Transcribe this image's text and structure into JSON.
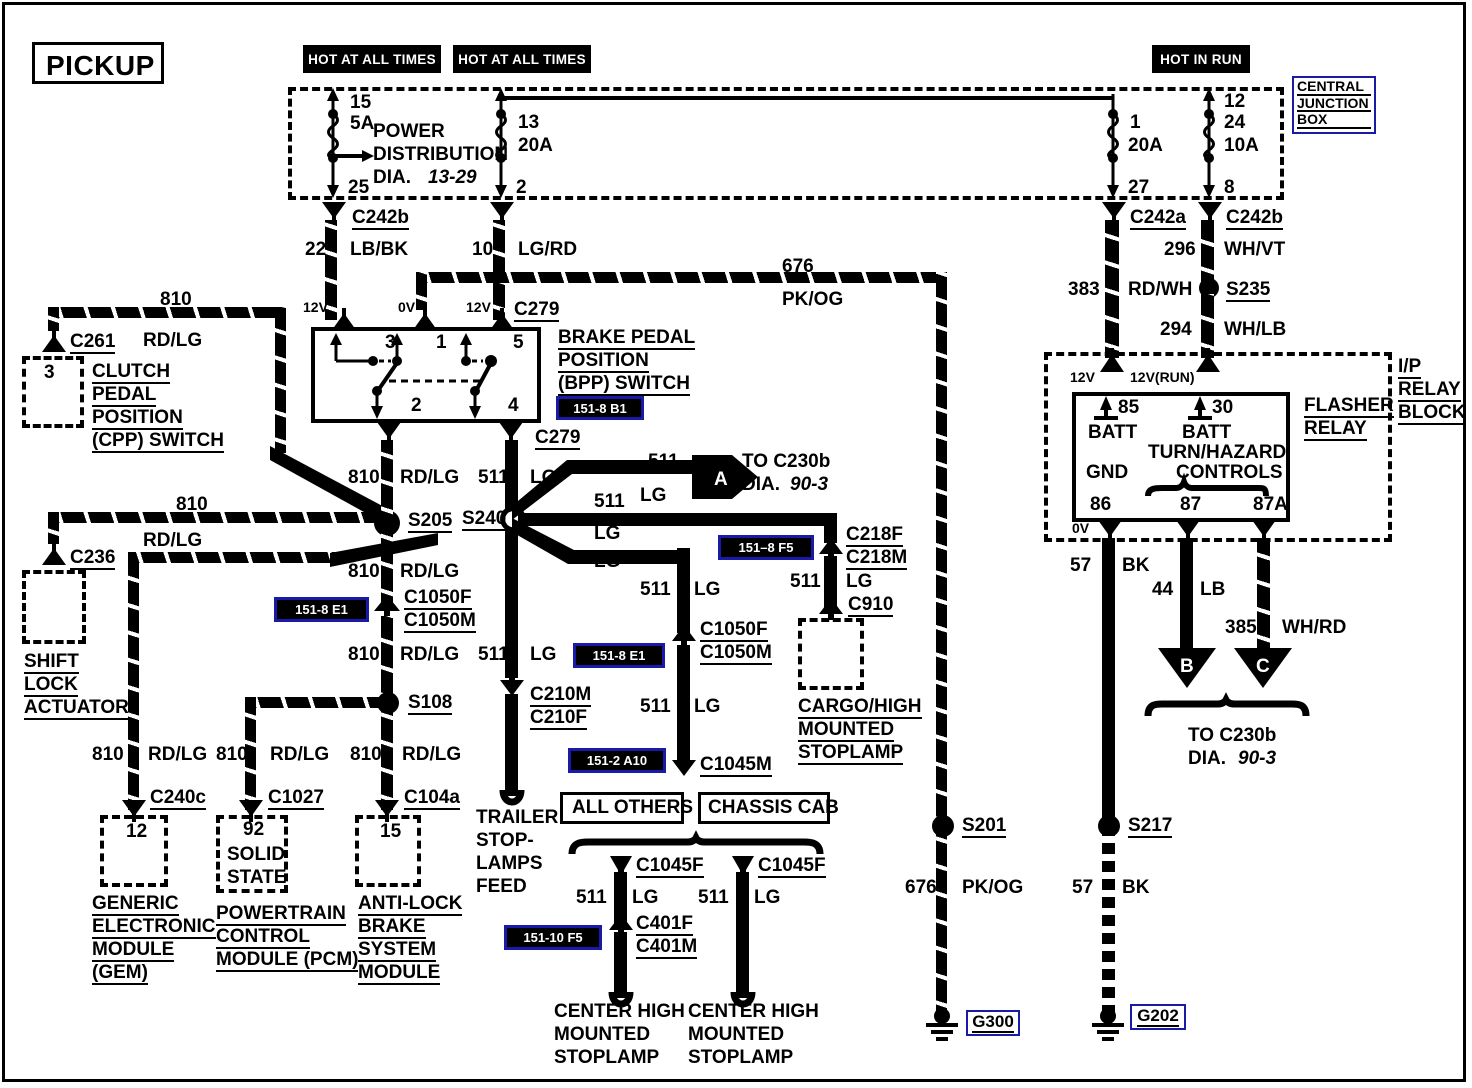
{
  "title": "PICKUP",
  "power_source_labels": {
    "hot_all_1": "HOT AT ALL TIMES",
    "hot_all_2": "HOT AT ALL TIMES",
    "hot_run": "HOT IN RUN"
  },
  "central_junction_box": {
    "label_line1": "CENTRAL",
    "label_line2": "JUNCTION",
    "label_line3": "BOX",
    "power_distribution": {
      "line1": "POWER",
      "line2": "DISTRIBUTION",
      "line3": "DIA.",
      "ref": "13-29"
    },
    "fuses": [
      {
        "top_pin": "15",
        "rating": "5A",
        "bottom_pin": "25"
      },
      {
        "top_pin": "13",
        "rating": "20A",
        "bottom_pin": "2"
      },
      {
        "top_pin": "1",
        "rating": "20A",
        "bottom_pin": "27"
      },
      {
        "top_pin": "12",
        "rating": "24",
        "rating2": "10A",
        "bottom_pin": "8"
      }
    ]
  },
  "connectors": {
    "c242b_left": "C242b",
    "c242a": "C242a",
    "c242b_right": "C242b",
    "c279_top": "C279",
    "c279_bottom": "C279",
    "c261": "C261",
    "c236": "C236",
    "c240c": "C240c",
    "c1027": "C1027",
    "c104a": "C104a",
    "c1050f_left": "C1050F",
    "c1050m_left": "C1050M",
    "c1050f_mid": "C1050F",
    "c1050m_mid": "C1050M",
    "c210m": "C210M",
    "c210f": "C210F",
    "c218f": "C218F",
    "c218m": "C218M",
    "c910": "C910",
    "c1045m": "C1045M",
    "c1045f_left": "C1045F",
    "c1045f_right": "C1045F",
    "c401f": "C401F",
    "c401m": "C401M"
  },
  "wires": {
    "lb_bk": {
      "gauge": "22",
      "color": "LB/BK"
    },
    "lg_rd": {
      "gauge": "10",
      "color": "LG/RD"
    },
    "pk_og_top": {
      "gauge": "676",
      "color": "PK/OG"
    },
    "rd_wh": {
      "gauge": "383",
      "color": "RD/WH"
    },
    "wh_vt": {
      "gauge": "296",
      "color": "WH/VT"
    },
    "wh_lb": {
      "gauge": "294",
      "color": "WH/LB"
    },
    "rd_lg_c261": {
      "gauge": "810",
      "color": "RD/LG"
    },
    "rd_lg_c236": {
      "gauge": "810",
      "color": "RD/LG"
    },
    "rd_lg_s205_up": {
      "gauge": "810",
      "color": "RD/LG"
    },
    "rd_lg_s205_dn": {
      "gauge": "810",
      "color": "RD/LG"
    },
    "rd_lg_s108_dn": {
      "gauge": "810",
      "color": "RD/LG"
    },
    "rd_lg_gem": {
      "gauge": "810",
      "color": "RD/LG"
    },
    "rd_lg_pcm": {
      "gauge": "810",
      "color": "RD/LG"
    },
    "rd_lg_abs": {
      "gauge": "810",
      "color": "RD/LG"
    },
    "lg_s240_up": {
      "gauge": "511",
      "color": "LG"
    },
    "lg_a_branch": {
      "gauge": "511",
      "color": "LG"
    },
    "lg_mid_branch": {
      "gauge": "511",
      "color": "LG"
    },
    "lg_low_branch": {
      "gauge": "511",
      "color": "LG"
    },
    "lg_trailer": {
      "gauge": "511",
      "color": "LG"
    },
    "lg_chmsl_feed": {
      "gauge": "511",
      "color": "LG"
    },
    "lg_chmsl_low": {
      "gauge": "511",
      "color": "LG"
    },
    "lg_cargo": {
      "gauge": "511",
      "color": "LG"
    },
    "lg_c1045f_left": {
      "gauge": "511",
      "color": "LG"
    },
    "lg_c1045f_right": {
      "gauge": "511",
      "color": "LG"
    },
    "bk_flasher": {
      "gauge": "57",
      "color": "BK"
    },
    "lb_flasher": {
      "gauge": "44",
      "color": "LB"
    },
    "wh_rd_flasher": {
      "gauge": "385",
      "color": "WH/RD"
    },
    "pk_og_ground": {
      "gauge": "676",
      "color": "PK/OG"
    },
    "bk_ground": {
      "gauge": "57",
      "color": "BK"
    }
  },
  "voltages": {
    "v_12_lbbk": "12V",
    "v_0_bpp": "0V",
    "v_12_lgrd": "12V",
    "v_12_flasher": "12V",
    "v_12run_flasher": "12V(RUN)",
    "v_0_gnd": "0V"
  },
  "bpp_switch": {
    "name_line1": "BRAKE PEDAL",
    "name_line2": "POSITION",
    "name_line3": "(BPP) SWITCH",
    "pins": [
      "3",
      "1",
      "5",
      "2",
      "4"
    ],
    "ref": "151-8 B1"
  },
  "cpp_switch": {
    "pin": "3",
    "name_line1": "CLUTCH",
    "name_line2": "PEDAL",
    "name_line3": "POSITION",
    "name_line4": "(CPP) SWITCH"
  },
  "shift_lock_actuator": {
    "name_line1": "SHIFT",
    "name_line2": "LOCK",
    "name_line3": "ACTUATOR"
  },
  "modules": [
    {
      "pin": "12",
      "inner": "",
      "name_lines": [
        "GENERIC",
        "ELECTRONIC",
        "MODULE",
        "(GEM)"
      ]
    },
    {
      "pin": "92",
      "inner": "SOLID STATE",
      "name_lines": [
        "POWERTRAIN",
        "CONTROL",
        "MODULE (PCM)"
      ]
    },
    {
      "pin": "15",
      "inner": "",
      "name_lines": [
        "ANTI-LOCK",
        "BRAKE",
        "SYSTEM",
        "MODULE"
      ]
    }
  ],
  "splices": {
    "s205": "S205",
    "s240": "S240",
    "s108": "S108",
    "s235": "S235",
    "s201": "S201",
    "s217": "S217"
  },
  "grounds": {
    "g300": "G300",
    "g202": "G202"
  },
  "refs": {
    "r_151_8_e1_left": "151-8 E1",
    "r_151_8_e1_mid": "151-8 E1",
    "r_151_8_f5": "151–8 F5",
    "r_151_2_a10": "151-2 A10",
    "r_151_10_f5": "151-10 F5",
    "r_151_8_b1": "151-8 B1"
  },
  "destinations": {
    "arrow_a": {
      "letter": "A",
      "line1": "TO C230b",
      "line2": "DIA.",
      "ref": "90-3"
    },
    "arrow_b": {
      "letter": "B"
    },
    "arrow_c": {
      "letter": "C"
    },
    "bc_group": {
      "line1": "TO C230b",
      "line2": "DIA.",
      "ref": "90-3"
    }
  },
  "flasher_relay": {
    "title_line1": "FLASHER",
    "title_line2": "RELAY",
    "pins": {
      "p85": "85",
      "p30": "30",
      "p86": "86",
      "p87": "87",
      "p87a": "87A"
    },
    "labels": {
      "batt_left": "BATT",
      "batt_right": "BATT",
      "turn_hazard": "TURN/HAZARD",
      "controls": "CONTROLS",
      "gnd": "GND"
    }
  },
  "ip_relay_block": {
    "line1": "I/P",
    "line2": "RELAY",
    "line3": "BLOCK"
  },
  "cargo_lamp": {
    "name_lines": [
      "CARGO/HIGH",
      "MOUNTED",
      "STOPLAMP"
    ]
  },
  "trailer": {
    "name_lines": [
      "TRAILER",
      "STOP-",
      "LAMPS",
      "FEED"
    ]
  },
  "variants": {
    "all_others": "ALL OTHERS",
    "chassis_cab": "CHASSIS CAB"
  },
  "chmsl_left": {
    "name_lines": [
      "CENTER HIGH",
      "MOUNTED",
      "STOPLAMP"
    ]
  },
  "chmsl_right": {
    "name_lines": [
      "CENTER HIGH",
      "MOUNTED",
      "STOPLAMP"
    ]
  },
  "colors": {
    "accent_blue": "#1a1aa8",
    "wire_black": "#000000",
    "background": "#ffffff"
  }
}
